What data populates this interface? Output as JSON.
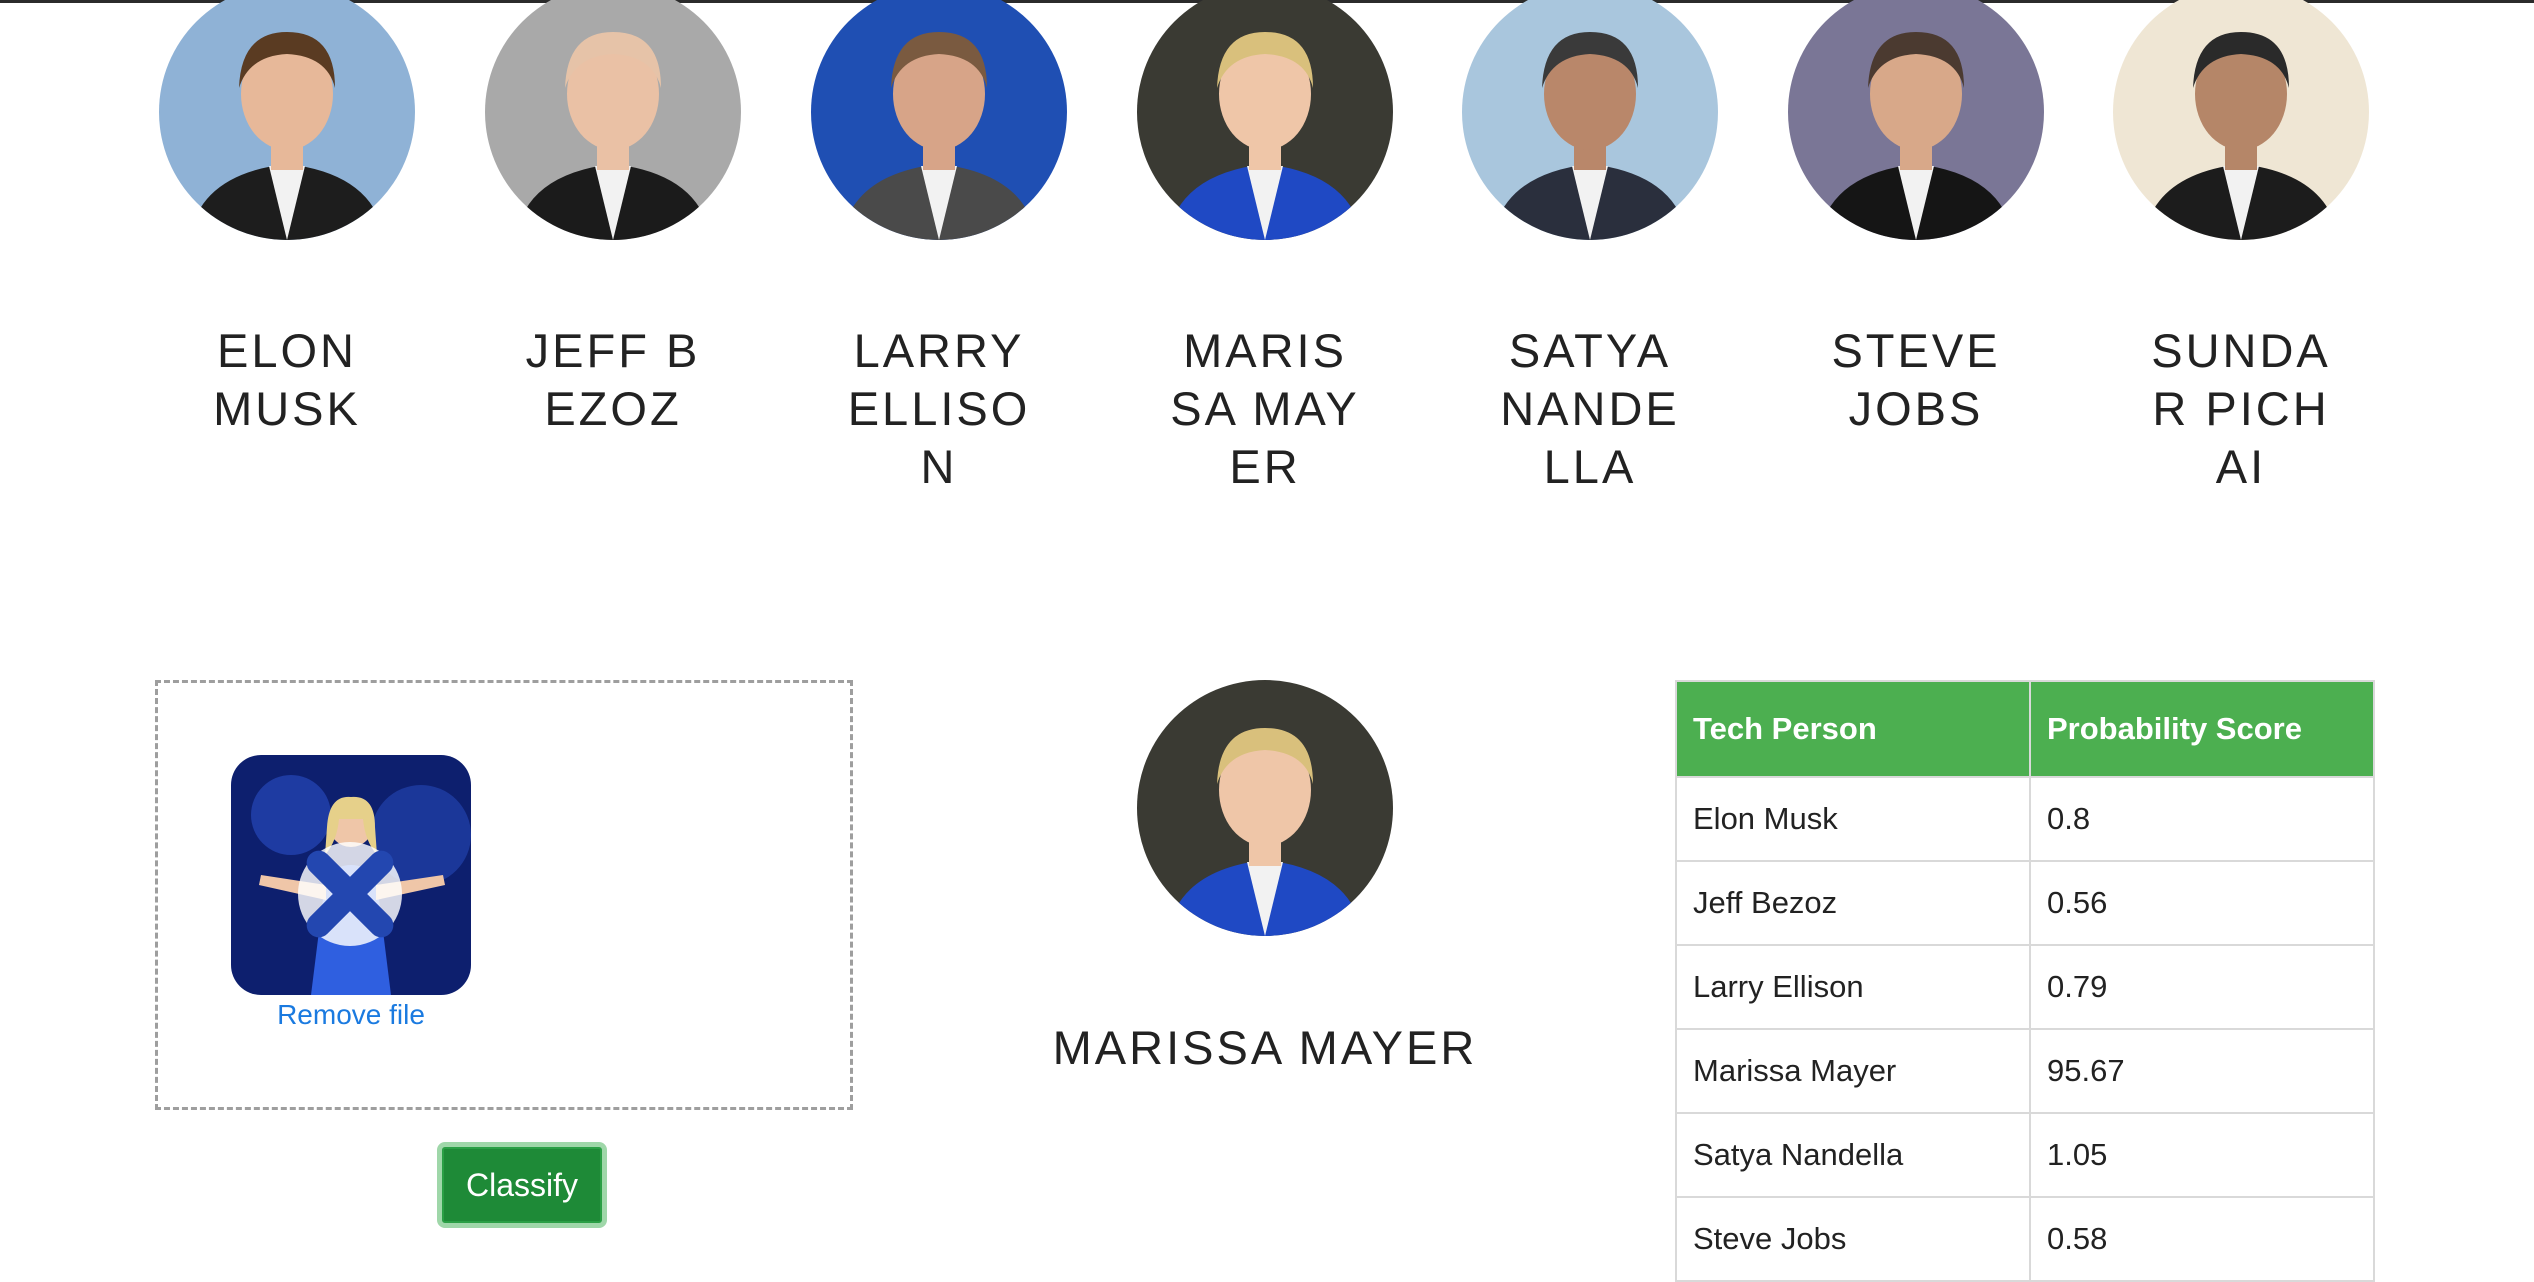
{
  "gallery": {
    "people": [
      {
        "name": "ELON MUSK",
        "avatar_icon": "elon-musk-photo",
        "bg": "#8fb2d6",
        "suit": "#1d1d1d",
        "hair": "#5a3b22",
        "skin": "#e7b899"
      },
      {
        "name": "JEFF BEZOZ",
        "avatar_icon": "jeff-bezos-photo",
        "bg": "#a9a9a9",
        "suit": "#1b1b1b",
        "hair": "#e6c3a8",
        "skin": "#eac1a5"
      },
      {
        "name": "LARRY ELLISON",
        "avatar_icon": "larry-ellison-photo",
        "bg": "#1f4fb3",
        "suit": "#4a4a4a",
        "hair": "#7a5a40",
        "skin": "#d7a488"
      },
      {
        "name": "MARISSA MAYER",
        "avatar_icon": "marissa-mayer-photo",
        "bg": "#3a3a33",
        "suit": "#1f49c4",
        "hair": "#d9c07c",
        "skin": "#efc6a8"
      },
      {
        "name": "SATYA NANDELLA",
        "avatar_icon": "satya-nadella-photo",
        "bg": "#a9c6dd",
        "suit": "#2a2f3d",
        "hair": "#3a3a3a",
        "skin": "#b9876a"
      },
      {
        "name": "STEVE JOBS",
        "avatar_icon": "steve-jobs-photo",
        "bg": "#7a7696",
        "suit": "#151515",
        "hair": "#4b3a30",
        "skin": "#d8a889"
      },
      {
        "name": "SUNDAR PICHAI",
        "avatar_icon": "sundar-pichai-photo",
        "bg": "#efe6d4",
        "suit": "#1c1c1c",
        "hair": "#2a2a2a",
        "skin": "#b58668"
      }
    ]
  },
  "upload": {
    "remove_label": "Remove file",
    "thumbnail_icon": "uploaded-image-thumbnail",
    "classify_label": "Classify"
  },
  "result": {
    "name": "MARISSA MAYER",
    "avatar_icon": "marissa-mayer-photo"
  },
  "table": {
    "headers": [
      "Tech Person",
      "Probability Score"
    ],
    "rows": [
      [
        "Elon Musk",
        "0.8"
      ],
      [
        "Jeff Bezoz",
        "0.56"
      ],
      [
        "Larry Ellison",
        "0.79"
      ],
      [
        "Marissa Mayer",
        "95.67"
      ],
      [
        "Satya Nandella",
        "1.05"
      ],
      [
        "Steve Jobs",
        "0.58"
      ]
    ]
  },
  "colors": {
    "header_green": "#4caf50",
    "button_green": "#1e8a37",
    "link_blue": "#1a7ae0"
  }
}
